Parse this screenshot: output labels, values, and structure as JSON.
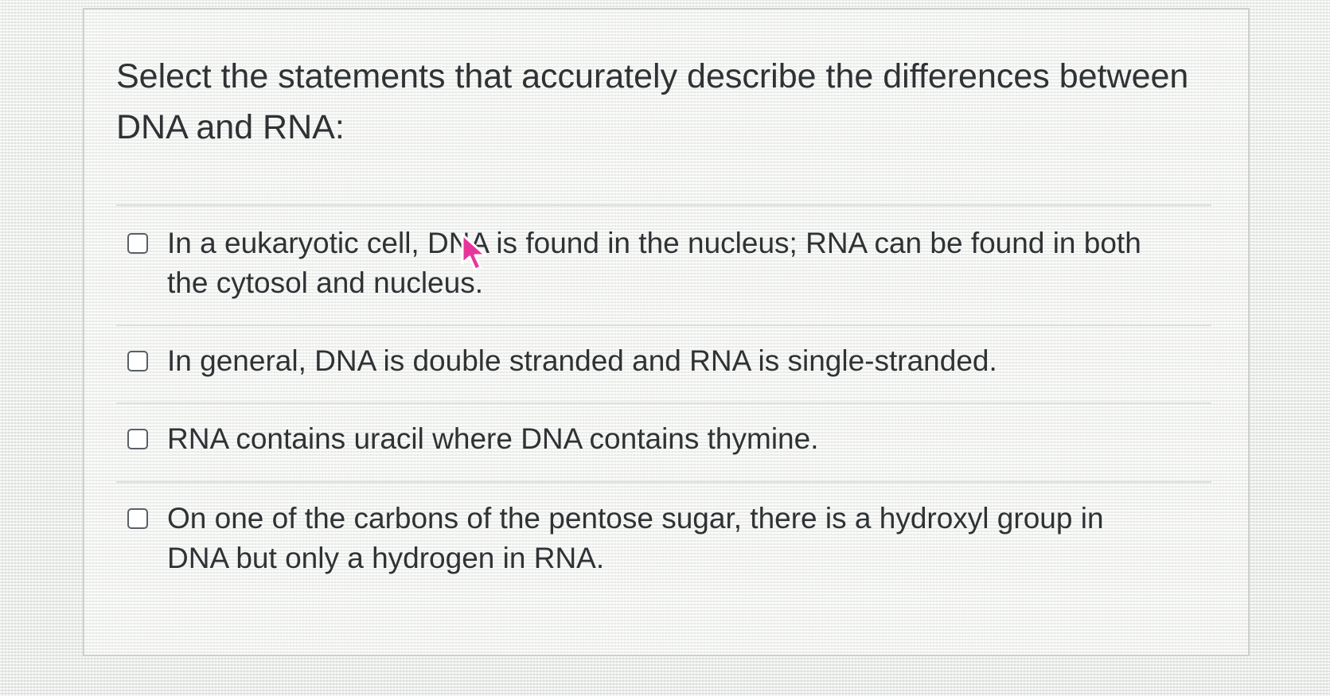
{
  "question": {
    "prompt": "Select the statements that accurately describe the differences between DNA and RNA:"
  },
  "options": [
    {
      "label": "In a eukaryotic cell, DNA is found in the nucleus; RNA can be found in both the cytosol and nucleus.",
      "checked": false
    },
    {
      "label": "In general, DNA is double stranded and RNA is single-stranded.",
      "checked": false
    },
    {
      "label": "RNA contains uracil where DNA contains thymine.",
      "checked": false
    },
    {
      "label": "On one of the carbons of the pentose sugar, there is a hydroxyl group in DNA but only a hydrogen in RNA.",
      "checked": false
    }
  ],
  "cursor": {
    "icon": "arrow-cursor-icon",
    "color": "#e8359a"
  }
}
